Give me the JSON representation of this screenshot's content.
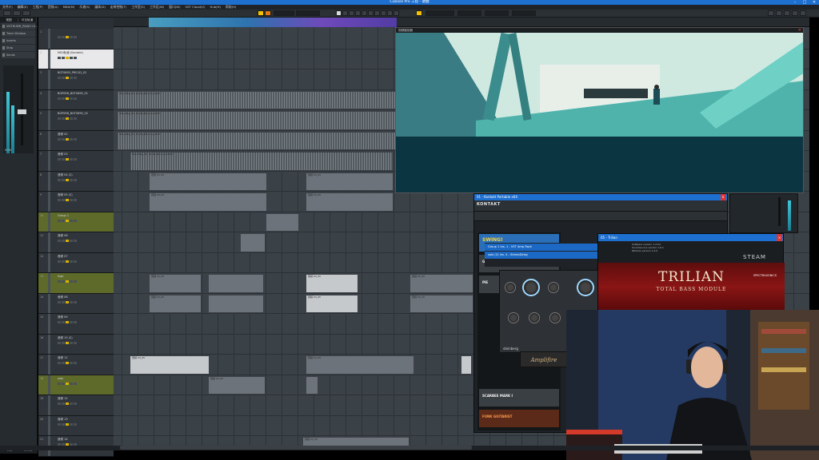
{
  "app": {
    "title": "Cubase Pro 工程 - 歌曲",
    "window_buttons": [
      "–",
      "□",
      "✕"
    ]
  },
  "menu": [
    "文件(F)",
    "编辑(E)",
    "工程(P)",
    "音频(A)",
    "MIDI(M)",
    "乐谱(S)",
    "媒体(D)",
    "走带控制(T)",
    "工作室(S)",
    "工作区(W)",
    "窗口(W)",
    "VST Cloud(V)",
    "Hub(H)",
    "帮助(H)"
  ],
  "inspector": {
    "tabs": [
      "视图",
      "可见轨道"
    ],
    "rows": [
      "VISTRUMR_PIANO+S...",
      "Track Window",
      "Inserts",
      "Strip",
      "Sends",
      "Notepad"
    ],
    "fader_value": "0.00",
    "footer_tabs": [
      "轨道",
      "编辑器"
    ],
    "colors": {
      "meter": "#3fc8d8"
    }
  },
  "tracks": [
    {
      "num": "1",
      "name": "",
      "type": "folder"
    },
    {
      "num": "2",
      "name": "MIDI轨道 (Kontakt)",
      "type": "selected"
    },
    {
      "num": "3",
      "name": "BGT0695_PRG1D_02",
      "type": "audio"
    },
    {
      "num": "4",
      "name": "BGP0R6_BGT0695_01",
      "type": "audio"
    },
    {
      "num": "5",
      "name": "BGP0R6_BGT0695_02",
      "type": "audio"
    },
    {
      "num": "6",
      "name": "音频 02",
      "type": "audio"
    },
    {
      "num": "7",
      "name": "音频 03",
      "type": "audio"
    },
    {
      "num": "8",
      "name": "音频 04 (2)",
      "type": "audio"
    },
    {
      "num": "9",
      "name": "音频 05 (2)",
      "type": "audio"
    },
    {
      "num": "10",
      "name": "Group 1",
      "type": "group"
    },
    {
      "num": "11",
      "name": "音频 06",
      "type": "audio"
    },
    {
      "num": "12",
      "name": "音频 07",
      "type": "audio"
    },
    {
      "num": "13",
      "name": "high",
      "type": "group"
    },
    {
      "num": "14",
      "name": "音频 08",
      "type": "audio"
    },
    {
      "num": "15",
      "name": "音频 09",
      "type": "audio"
    },
    {
      "num": "16",
      "name": "音频 10 (2)",
      "type": "audio"
    },
    {
      "num": "17",
      "name": "音频 11",
      "type": "audio"
    },
    {
      "num": "18",
      "name": "solo",
      "type": "group"
    },
    {
      "num": "19",
      "name": "音频 12",
      "type": "audio"
    },
    {
      "num": "20",
      "name": "音频 13",
      "type": "audio"
    },
    {
      "num": "21",
      "name": "音频 14",
      "type": "audio"
    }
  ],
  "clips": {
    "wave_label": "Wav_Bag_PC_01_Ra_Bounce_0077",
    "short_label": "音频 03_05"
  },
  "video_window": {
    "title": "视频播放器"
  },
  "kontakt": {
    "title": "01 - Kontakt Portable x64",
    "logo": "KONTAKT",
    "libraries": [
      {
        "name": "SWING!",
        "style": "swing"
      },
      {
        "name": "GU",
        "style": ""
      },
      {
        "name": "PIE",
        "style": ""
      },
      {
        "name": "SCARBEE MARK I",
        "style": ""
      },
      {
        "name": "FUNK GUITARIST",
        "style": "funk"
      }
    ],
    "strip_rows": [
      "Group 1 Ins. 1 - VST Amp Rack",
      "solo (2) Ins. 4 - StereoDelay"
    ],
    "amp_vendor": "steinberg",
    "amp_model": "Amplifire"
  },
  "trilian": {
    "window_title": "05 - Trilian",
    "title": "TRILIAN",
    "subtitle": "TOTAL BASS MODULE",
    "brand": "SPECTRASONICS",
    "host": "STEAM",
    "readout": [
      "Software version 1.4.5d",
      "Soundsource version 1.6.1",
      "Patches version 1.4.0"
    ]
  },
  "toolbar": {
    "colors": {
      "accent": "#f2c200",
      "record": "#e07a10"
    }
  }
}
